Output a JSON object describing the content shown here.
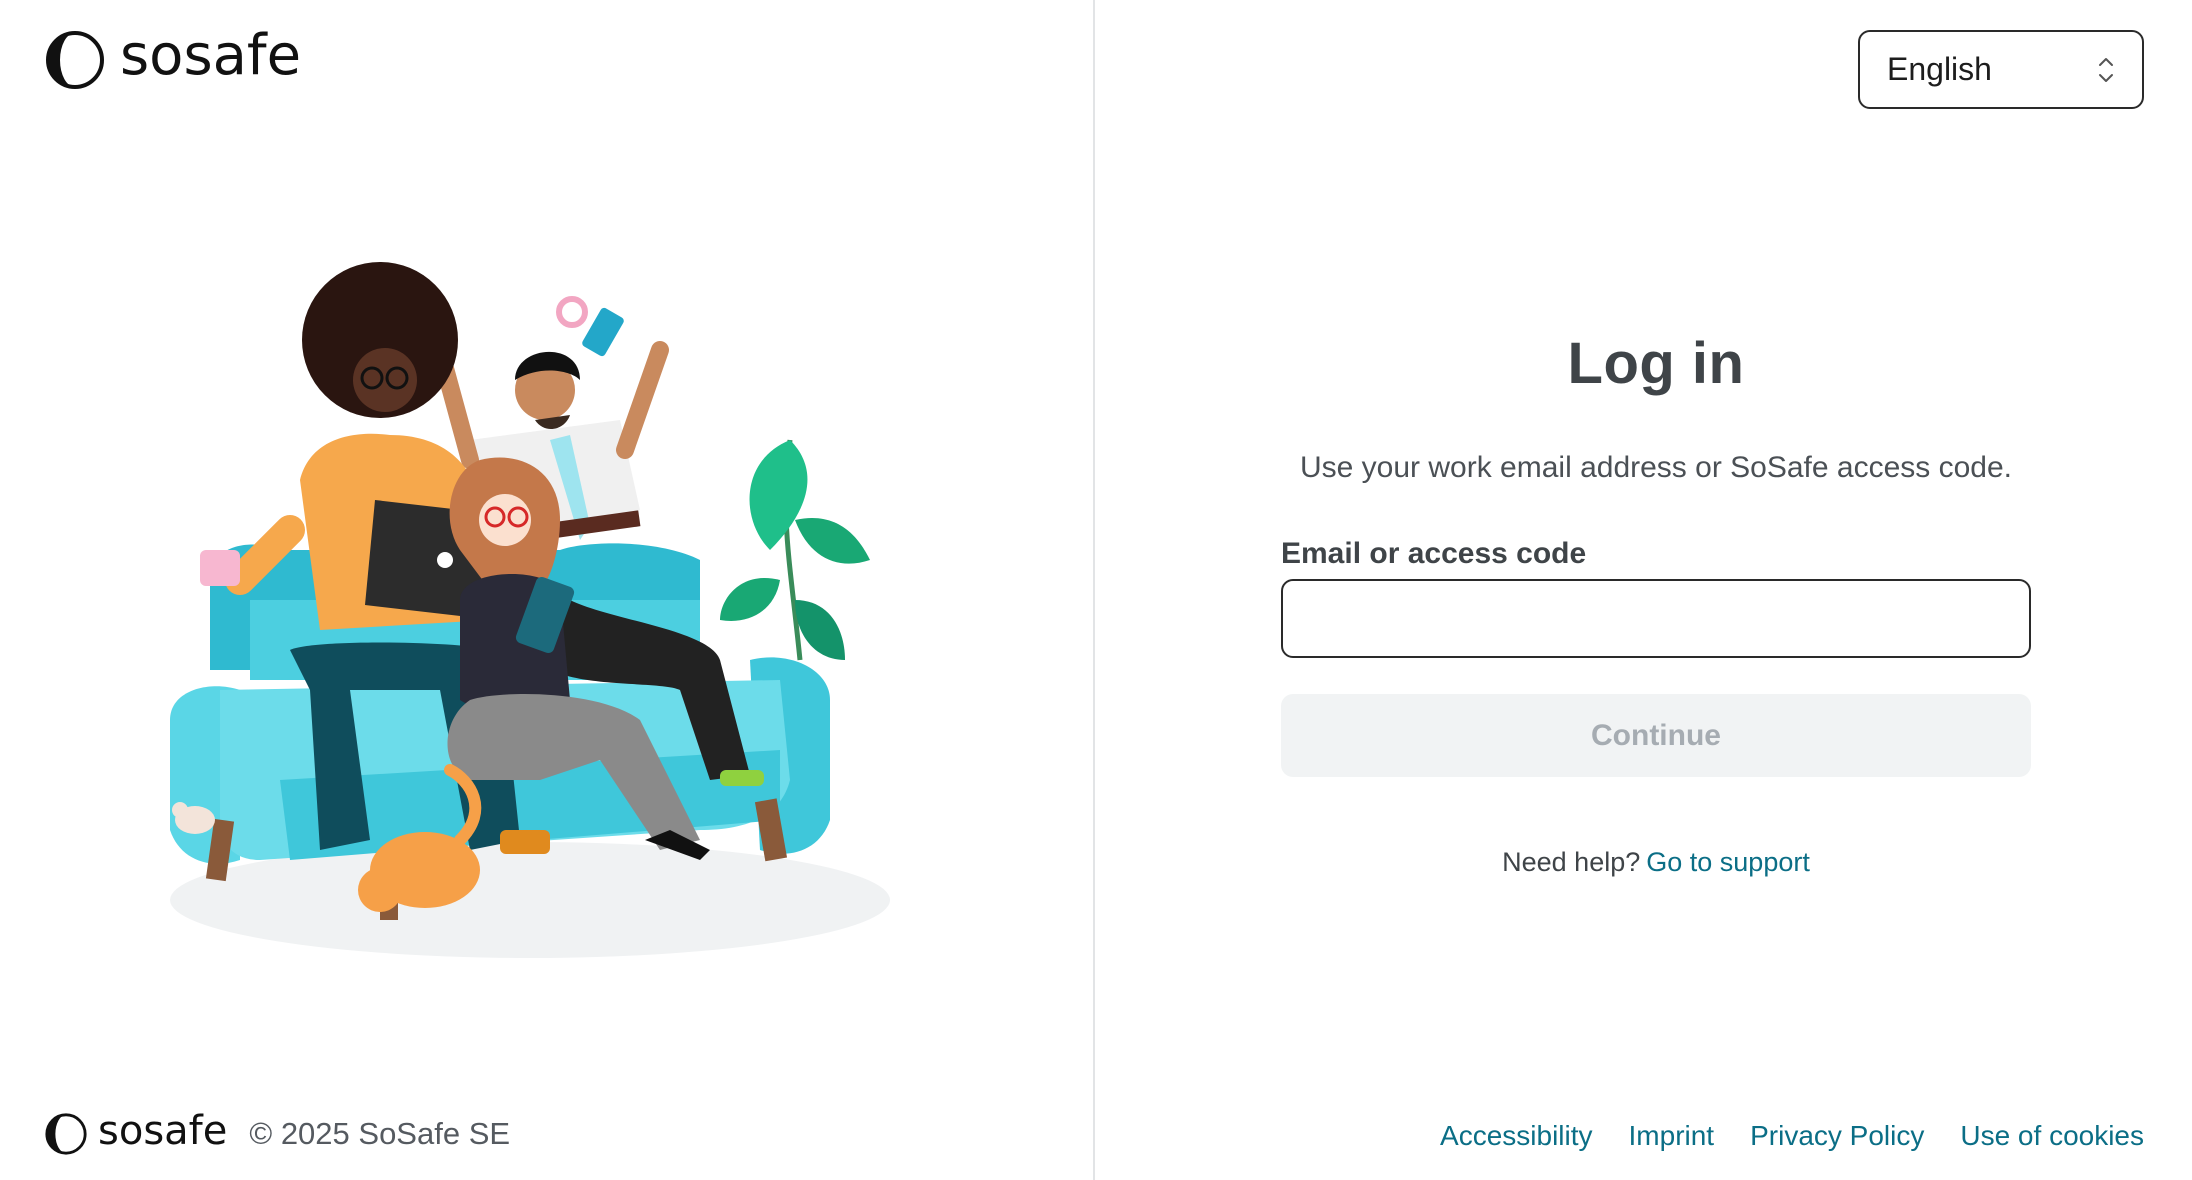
{
  "brand": {
    "name": "sosafe"
  },
  "left_footer": {
    "brand": "sosafe",
    "copyright": "© 2025 SoSafe SE"
  },
  "language_selector": {
    "value": "English",
    "icon": "chevron-up-down-icon"
  },
  "login": {
    "title": "Log in",
    "subtitle": "Use your work email address or SoSafe access code.",
    "field_label": "Email or access code",
    "field_value": "",
    "continue_label": "Continue",
    "help_text": "Need help?",
    "help_link": "Go to support"
  },
  "footer_links": [
    "Accessibility",
    "Imprint",
    "Privacy Policy",
    "Use of cookies"
  ],
  "colors": {
    "link": "#0b6e86",
    "button_disabled_bg": "#f1f3f4",
    "button_disabled_text": "#a6acb2",
    "sofa": "#4ccfe0"
  }
}
